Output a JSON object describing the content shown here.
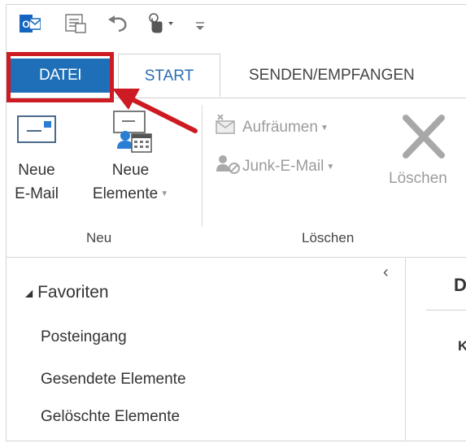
{
  "quick_access": {
    "icons": [
      "outlook-logo-icon",
      "send-receive-icon",
      "undo-icon",
      "touch-mode-icon",
      "customize-toolbar-icon"
    ],
    "logo_text": "O"
  },
  "tabs": [
    {
      "label": "DATEI",
      "active": false,
      "highlighted": true
    },
    {
      "label": "START",
      "active": true
    },
    {
      "label": "SENDEN/EMPFANGEN",
      "active": false
    }
  ],
  "ribbon": {
    "group_new": {
      "label": "Neu",
      "new_email": {
        "line1": "Neue",
        "line2": "E-Mail"
      },
      "new_items": {
        "line1": "Neue",
        "line2": "Elemente"
      }
    },
    "group_delete": {
      "label": "Löschen",
      "cleanup": "Aufräumen",
      "junk": "Junk-E-Mail",
      "delete": "Löschen"
    }
  },
  "folder_pane": {
    "favorites_label": "Favoriten",
    "items": [
      "Posteingang",
      "Gesendete Elemente",
      "Gelöschte Elemente"
    ]
  },
  "message_pane": {
    "header_char": "D",
    "sub_char": "K"
  },
  "colors": {
    "file_tab": "#1e6fb8",
    "start_tab_text": "#2a6db3",
    "highlight": "#cc1b22"
  }
}
